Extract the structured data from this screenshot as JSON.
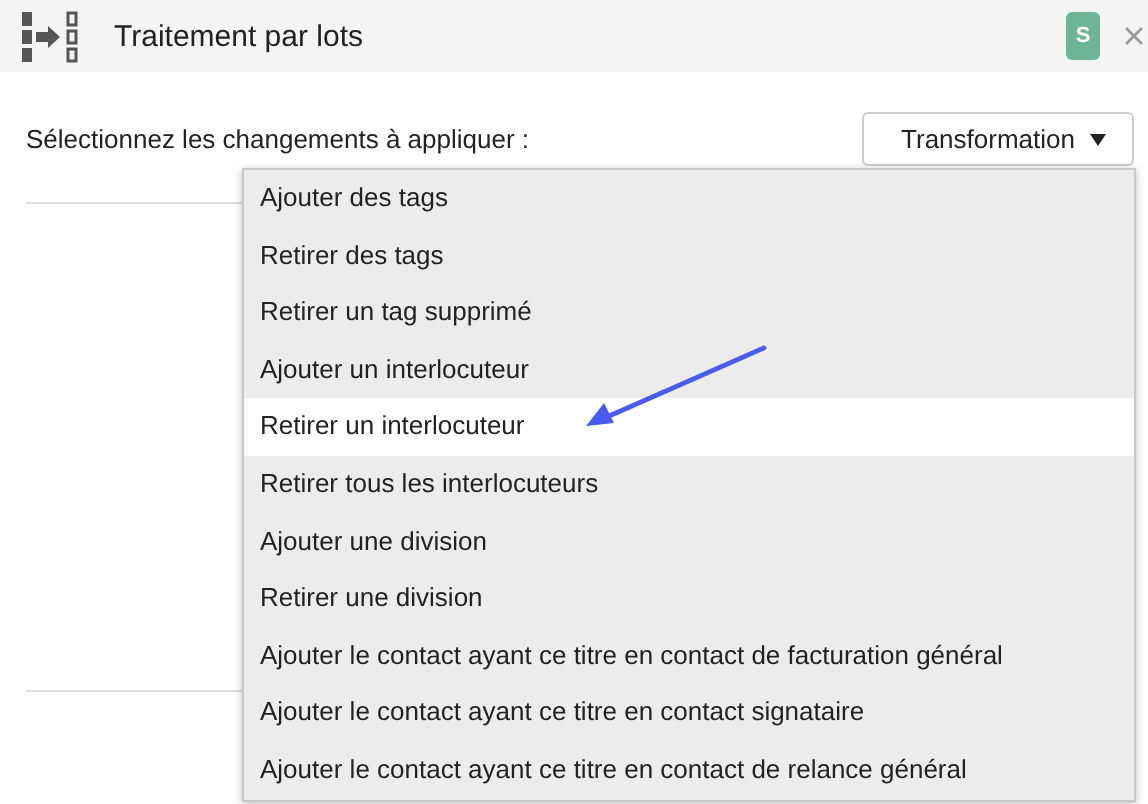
{
  "window": {
    "title": "Traitement par lots",
    "badge": "S"
  },
  "prompt": "Sélectionnez les changements à appliquer :",
  "dropdown": {
    "label": "Transformation",
    "expanded": true
  },
  "menu": {
    "items": [
      {
        "label": "Ajouter des tags",
        "selected": false
      },
      {
        "label": "Retirer des tags",
        "selected": false
      },
      {
        "label": "Retirer un tag supprimé",
        "selected": false
      },
      {
        "label": "Ajouter un interlocuteur",
        "selected": false
      },
      {
        "label": "Retirer un interlocuteur",
        "selected": true
      },
      {
        "label": "Retirer tous les interlocuteurs",
        "selected": false
      },
      {
        "label": "Ajouter une division",
        "selected": false
      },
      {
        "label": "Retirer une division",
        "selected": false
      },
      {
        "label": "Ajouter le contact ayant ce titre en contact de facturation général",
        "selected": false
      },
      {
        "label": "Ajouter le contact ayant ce titre en contact signataire",
        "selected": false
      },
      {
        "label": "Ajouter le contact ayant ce titre en contact de relance général",
        "selected": false
      }
    ]
  }
}
